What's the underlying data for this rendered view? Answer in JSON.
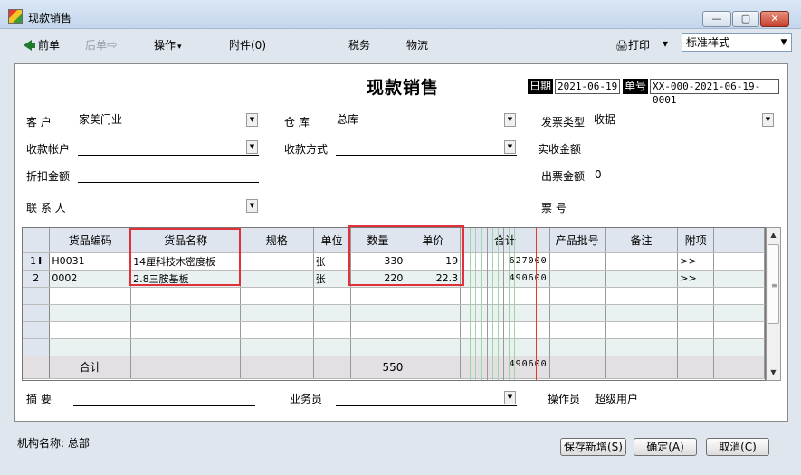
{
  "window": {
    "title": "现款销售",
    "min": "—",
    "max": "▢",
    "close": "✕"
  },
  "toolbar": {
    "prev": "前单",
    "next": "后单",
    "next_arrow": "⇨",
    "operate": "操作",
    "attach": "附件(0)",
    "tax": "税务",
    "logistics": "物流",
    "print": "打印",
    "print_caret": "▾",
    "operate_caret": "▾",
    "print_style": "标准样式",
    "printer_icon": "🖨"
  },
  "form": {
    "title": "现款销售",
    "date_label": "日期",
    "date_value": "2021-06-19",
    "no_label": "单号",
    "no_value": "XX-000-2021-06-19-0001",
    "customer_label": "客  户",
    "customer_value": "家美门业",
    "warehouse_label": "仓  库",
    "warehouse_value": "总库",
    "invoice_type_label": "发票类型",
    "invoice_type_value": "收据",
    "account_label": "收款帐户",
    "account_value": "",
    "pay_method_label": "收款方式",
    "pay_method_value": "",
    "received_label": "实收金额",
    "received_value": "",
    "discount_label": "折扣金额",
    "discount_value": "",
    "invoice_amount_label": "出票金额",
    "invoice_amount_value": "0",
    "contact_label": "联 系 人",
    "contact_value": "",
    "ticket_label": "票   号",
    "ticket_value": "",
    "memo_label": "摘  要",
    "memo_value": "",
    "salesman_label": "业务员",
    "salesman_value": "",
    "operator_label": "操作员",
    "operator_value": "超级用户"
  },
  "grid": {
    "columns": [
      "货品编码",
      "货品名称",
      "规格",
      "单位",
      "数量",
      "单价",
      "合计",
      "产品批号",
      "备注",
      "附项"
    ],
    "rows": [
      {
        "num": "1",
        "code": "H0031",
        "name": "14厘科技木密度板",
        "spec": "",
        "unit": "张",
        "qty": "330",
        "price": "19",
        "total": "627000",
        "batch": "",
        "note": "",
        "extra": ">>"
      },
      {
        "num": "2",
        "code": "0002",
        "name": "2.8三胺基板",
        "spec": "",
        "unit": "张",
        "qty": "220",
        "price": "22.3",
        "total": "490600",
        "batch": "",
        "note": "",
        "extra": ">>"
      }
    ],
    "total_label": "合计",
    "total_qty": "550",
    "total_amount": "490600",
    "row1_cursor": "I"
  },
  "footer": {
    "org_label": "机构名称:",
    "org_value": "总部",
    "save_new": "保存新增(S)",
    "confirm": "确定(A)",
    "cancel": "取消(C)"
  },
  "colors": {
    "highlight": "#e0303a",
    "titlebar": "#c4d6ec"
  }
}
